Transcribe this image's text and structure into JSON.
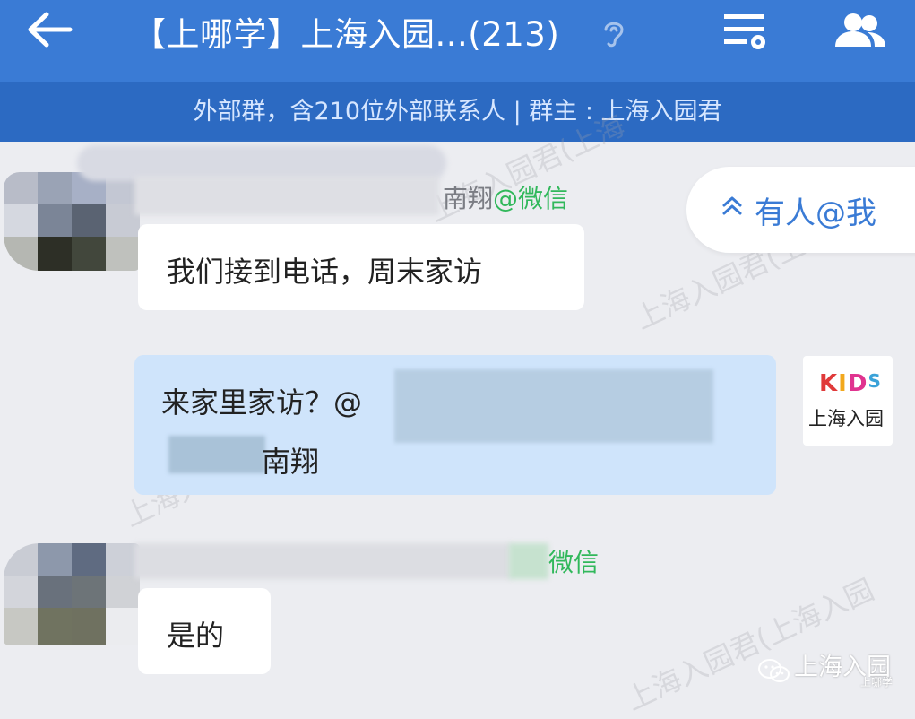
{
  "header": {
    "back_icon": "arrow-left-icon",
    "title": "【上哪学】上海入园...(213)",
    "ear_icon": "earpiece-mode-icon",
    "menu_icon": "chat-settings-icon",
    "members_icon": "group-members-icon"
  },
  "subheader": {
    "text": "外部群，含210位外部联系人 | 群主 : 上海入园君"
  },
  "at_me": {
    "label": "有人@我",
    "icon": "chevrons-up-icon"
  },
  "messages": [
    {
      "sender_visible": "南翔",
      "sender_suffix": "@微信",
      "text": "我们接到电话，周末家访"
    },
    {
      "line1": "来家里家访？@",
      "line2": "南翔",
      "avatar_top": "KIDS",
      "avatar_bottom": "上海入园"
    },
    {
      "sender_suffix": "微信",
      "text": "是的"
    }
  ],
  "watermarks": [
    "上海入园君(上海",
    "上海入园君(上",
    "上海入园君(上海入园",
    "上海入园君(上海入园"
  ],
  "bottom_watermark": {
    "icon": "wechat-icon",
    "text": "上海入园",
    "small": "上哪学"
  },
  "colors": {
    "titlebar": "#3a7bd5",
    "subbar": "#2c6ac2",
    "wechat_green": "#31b85b",
    "self_bubble": "#cfe4fb"
  }
}
